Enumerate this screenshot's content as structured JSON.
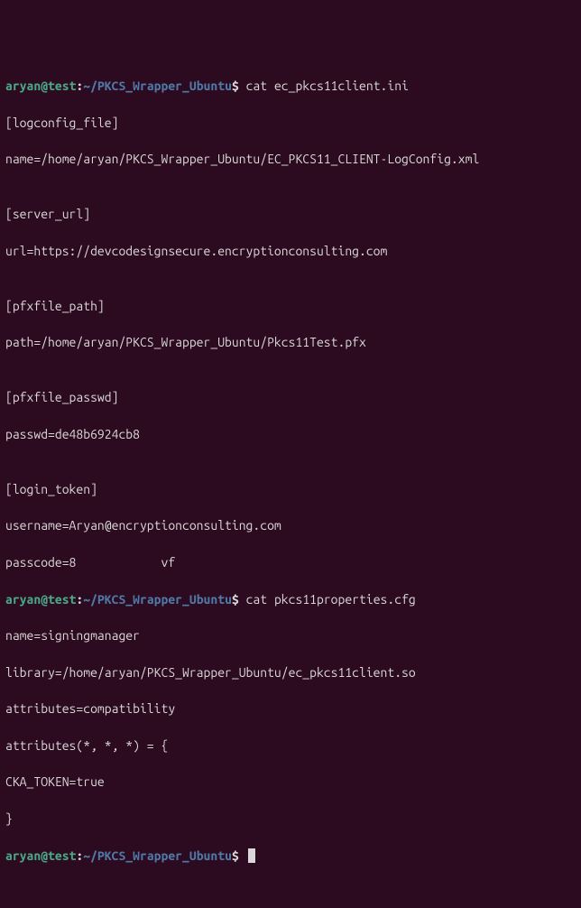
{
  "prompt1": {
    "user": "aryan",
    "at": "@",
    "host": "test",
    "colon": ":",
    "path": "~/PKCS_Wrapper_Ubuntu",
    "dollar": "$ ",
    "command": "cat ec_pkcs11client.ini"
  },
  "ini": {
    "section1": "[logconfig_file]",
    "line1": "name=/home/aryan/PKCS_Wrapper_Ubuntu/EC_PKCS11_CLIENT-LogConfig.xml",
    "blank1": "",
    "section2": "[server_url]",
    "line2": "url=https://devcodesignsecure.encryptionconsulting.com",
    "blank2": "",
    "section3": "[pfxfile_path]",
    "line3": "path=/home/aryan/PKCS_Wrapper_Ubuntu/Pkcs11Test.pfx",
    "blank3": "",
    "section4": "[pfxfile_passwd]",
    "line4": "passwd=de48b6924cb8",
    "blank4": "",
    "section5": "[login_token]",
    "line5": "username=Aryan@encryptionconsulting.com",
    "line6": "passcode=8            vf"
  },
  "prompt2": {
    "user": "aryan",
    "at": "@",
    "host": "test",
    "colon": ":",
    "path": "~/PKCS_Wrapper_Ubuntu",
    "dollar": "$ ",
    "command": "cat pkcs11properties.cfg"
  },
  "cfg": {
    "line1": "name=signingmanager",
    "line2": "library=/home/aryan/PKCS_Wrapper_Ubuntu/ec_pkcs11client.so",
    "line3": "attributes=compatibility",
    "line4": "attributes(*, *, *) = {",
    "line5": "CKA_TOKEN=true",
    "line6": "}"
  },
  "prompt3": {
    "user": "aryan",
    "at": "@",
    "host": "test",
    "colon": ":",
    "path": "~/PKCS_Wrapper_Ubuntu",
    "dollar": "$ "
  }
}
